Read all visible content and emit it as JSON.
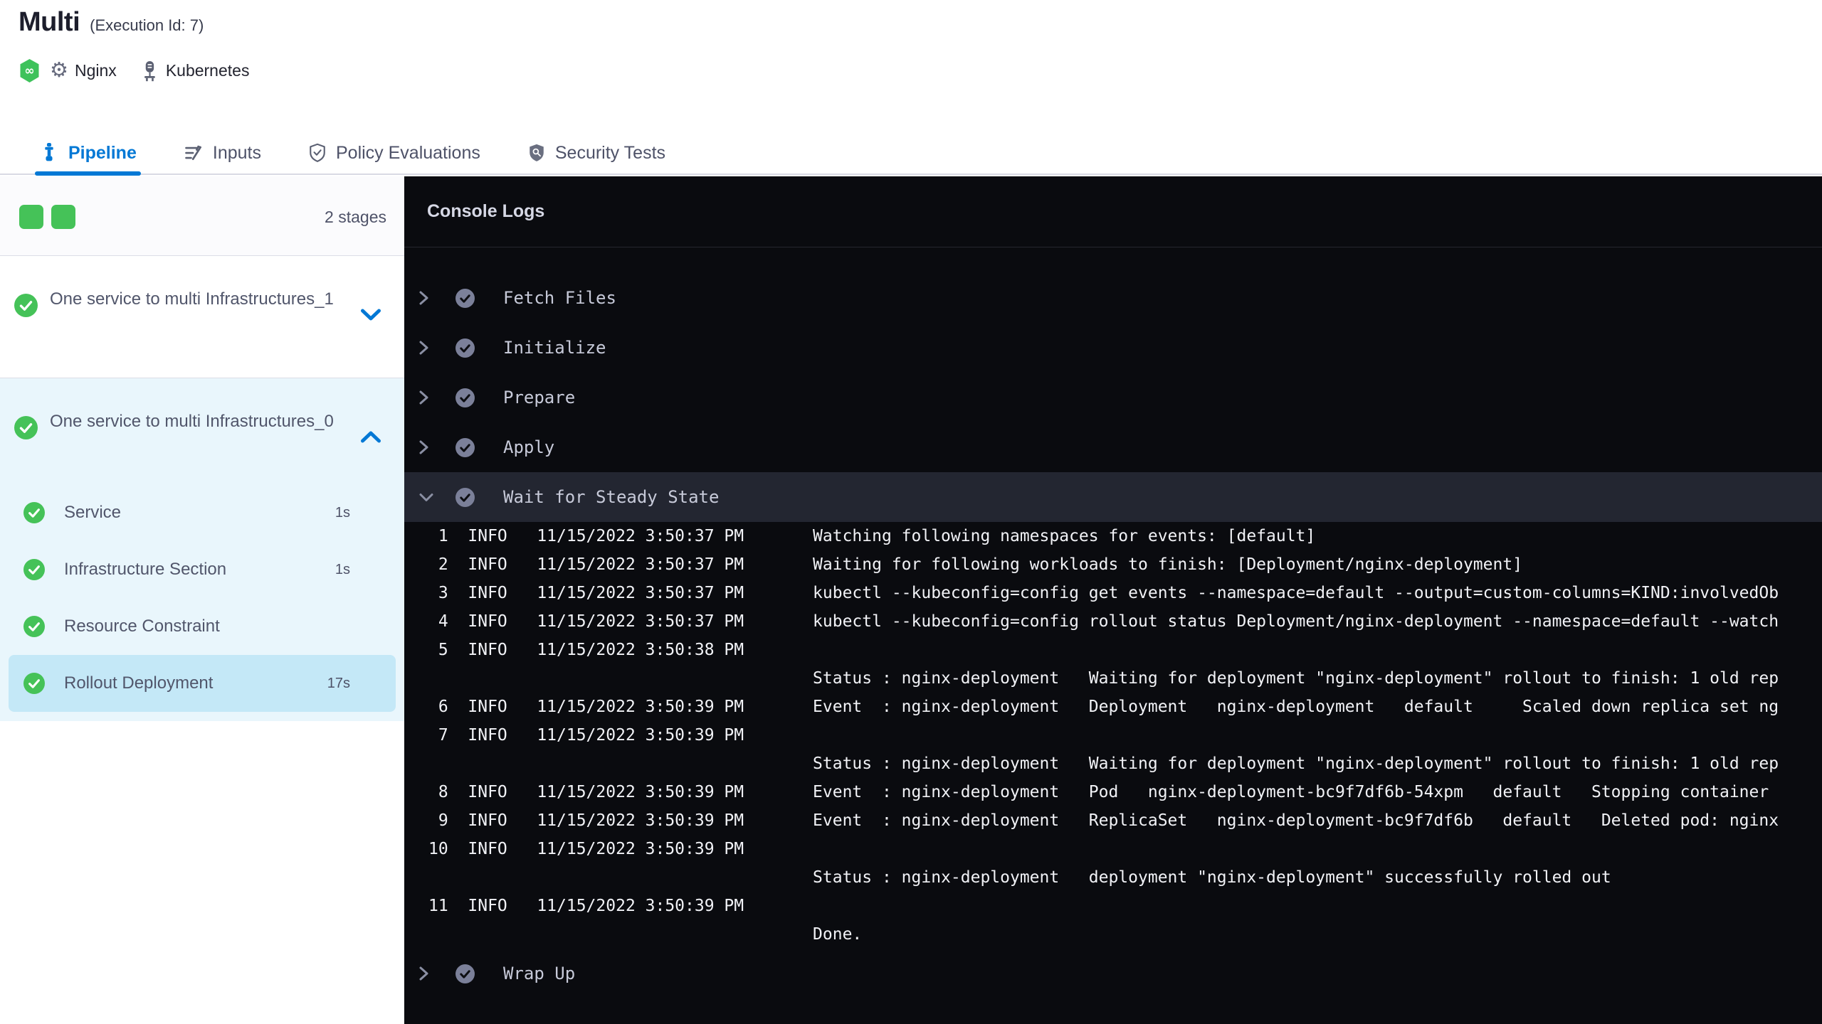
{
  "header": {
    "title": "Multi",
    "subtitle": "(Execution Id: 7)",
    "status_icon": "harness-success-badge",
    "service": {
      "icon": "gear-icon",
      "label": "Nginx"
    },
    "infrastructure": {
      "icon": "kubernetes-icon",
      "label": "Kubernetes"
    }
  },
  "tabs": [
    {
      "label": "Pipeline",
      "icon": "pipeline-icon",
      "active": true
    },
    {
      "label": "Inputs",
      "icon": "inputs-icon",
      "active": false
    },
    {
      "label": "Policy Evaluations",
      "icon": "policy-shield-check-icon",
      "active": false
    },
    {
      "label": "Security Tests",
      "icon": "security-shield-search-icon",
      "active": false
    }
  ],
  "sidebar": {
    "stages_summary": {
      "count_label": "2 stages",
      "indicators": [
        "success",
        "success"
      ]
    },
    "stages": [
      {
        "name": "One service to multi Infrastructures_1",
        "status": "success",
        "expanded": false,
        "steps": []
      },
      {
        "name": "One service to multi Infrastructures_0",
        "status": "success",
        "expanded": true,
        "steps": [
          {
            "label": "Service",
            "duration": "1s",
            "status": "success",
            "selected": false
          },
          {
            "label": "Infrastructure Section",
            "duration": "1s",
            "status": "success",
            "selected": false
          },
          {
            "label": "Resource Constraint",
            "duration": "",
            "status": "success",
            "selected": false
          },
          {
            "label": "Rollout Deployment",
            "duration": "17s",
            "status": "success",
            "selected": true
          }
        ]
      }
    ]
  },
  "console": {
    "title": "Console Logs",
    "steps": [
      {
        "label": "Fetch Files",
        "status": "success",
        "expanded": false
      },
      {
        "label": "Initialize",
        "status": "success",
        "expanded": false
      },
      {
        "label": "Prepare",
        "status": "success",
        "expanded": false
      },
      {
        "label": "Apply",
        "status": "success",
        "expanded": false
      },
      {
        "label": "Wait for Steady State",
        "status": "success",
        "expanded": true,
        "logs": [
          {
            "num": "1",
            "level": "INFO",
            "time": "11/15/2022 3:50:37 PM",
            "message": "Watching following namespaces for events: [default]"
          },
          {
            "num": "2",
            "level": "INFO",
            "time": "11/15/2022 3:50:37 PM",
            "message": "Waiting for following workloads to finish: [Deployment/nginx-deployment]"
          },
          {
            "num": "3",
            "level": "INFO",
            "time": "11/15/2022 3:50:37 PM",
            "message": "kubectl --kubeconfig=config get events --namespace=default --output=custom-columns=KIND:involvedOb"
          },
          {
            "num": "4",
            "level": "INFO",
            "time": "11/15/2022 3:50:37 PM",
            "message": "kubectl --kubeconfig=config rollout status Deployment/nginx-deployment --namespace=default --watch"
          },
          {
            "num": "5",
            "level": "INFO",
            "time": "11/15/2022 3:50:38 PM",
            "message": ""
          },
          {
            "num": "",
            "level": "",
            "time": "",
            "message": "Status : nginx-deployment   Waiting for deployment \"nginx-deployment\" rollout to finish: 1 old rep"
          },
          {
            "num": "6",
            "level": "INFO",
            "time": "11/15/2022 3:50:39 PM",
            "message": "Event  : nginx-deployment   Deployment   nginx-deployment   default     Scaled down replica set ng"
          },
          {
            "num": "7",
            "level": "INFO",
            "time": "11/15/2022 3:50:39 PM",
            "message": ""
          },
          {
            "num": "",
            "level": "",
            "time": "",
            "message": "Status : nginx-deployment   Waiting for deployment \"nginx-deployment\" rollout to finish: 1 old rep"
          },
          {
            "num": "8",
            "level": "INFO",
            "time": "11/15/2022 3:50:39 PM",
            "message": "Event  : nginx-deployment   Pod   nginx-deployment-bc9f7df6b-54xpm   default   Stopping container"
          },
          {
            "num": "9",
            "level": "INFO",
            "time": "11/15/2022 3:50:39 PM",
            "message": "Event  : nginx-deployment   ReplicaSet   nginx-deployment-bc9f7df6b   default   Deleted pod: nginx"
          },
          {
            "num": "10",
            "level": "INFO",
            "time": "11/15/2022 3:50:39 PM",
            "message": ""
          },
          {
            "num": "",
            "level": "",
            "time": "",
            "message": "Status : nginx-deployment   deployment \"nginx-deployment\" successfully rolled out"
          },
          {
            "num": "11",
            "level": "INFO",
            "time": "11/15/2022 3:50:39 PM",
            "message": ""
          },
          {
            "num": "",
            "level": "",
            "time": "",
            "message": "Done."
          }
        ]
      },
      {
        "label": "Wrap Up",
        "status": "success",
        "expanded": false
      }
    ]
  },
  "colors": {
    "accent_blue": "#0278d5",
    "success_green": "#45c258",
    "stage_group_bg": "#e9f6fc",
    "selected_step_bg": "#c4e8f7",
    "console_bg": "#0a0b0f",
    "console_highlight_row": "#232631",
    "text_primary": "#1d1e2c",
    "text_secondary": "#4e5268",
    "log_text": "#f1f2f6"
  }
}
